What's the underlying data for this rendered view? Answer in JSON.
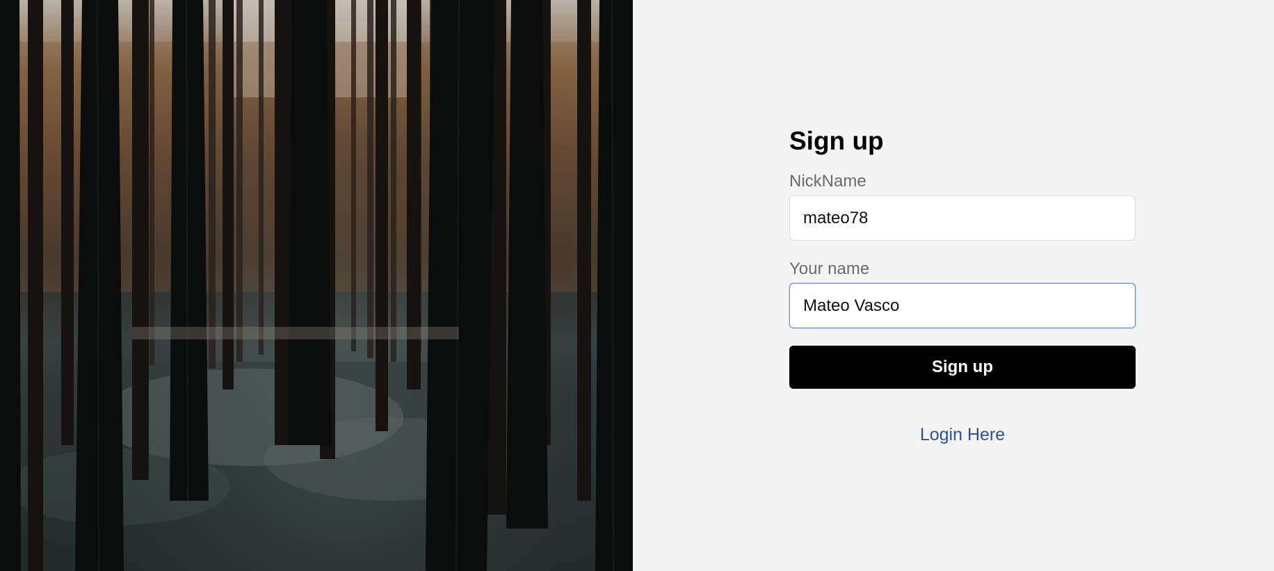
{
  "hero": {
    "image": "dark-forest-photo"
  },
  "form": {
    "title": "Sign up",
    "nickname": {
      "label": "NickName",
      "value": "mateo78"
    },
    "name": {
      "label": "Your name",
      "value": "Mateo Vasco"
    },
    "submit_label": "Sign up",
    "login_link": "Login Here"
  },
  "colors": {
    "background": "#f4f4f4",
    "button": "#000000",
    "link": "#2f4f9a",
    "focus_border": "#5b8ed6"
  }
}
